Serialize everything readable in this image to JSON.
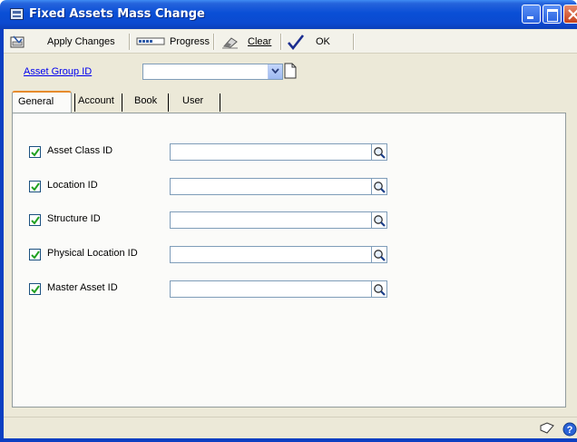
{
  "window": {
    "title": "Fixed Assets Mass Change",
    "icon": "window-form-icon",
    "controls": [
      "minimize-icon",
      "maximize-icon",
      "close-icon"
    ]
  },
  "toolbar": {
    "apply_changes": {
      "label": "Apply Changes",
      "icon": "apply-changes-icon"
    },
    "progress": {
      "label": "Progress",
      "icon": "progress-icon"
    },
    "clear": {
      "label": "Clear",
      "icon": "clear-eraser-icon"
    },
    "ok": {
      "label": "OK",
      "icon": "checkmark-icon"
    }
  },
  "header": {
    "asset_group_label": "Asset Group ID",
    "asset_group_value": ""
  },
  "tabs": [
    {
      "label": "General",
      "active": true
    },
    {
      "label": "Account",
      "active": false
    },
    {
      "label": "Book",
      "active": false
    },
    {
      "label": "User",
      "active": false
    }
  ],
  "fields": [
    {
      "label": "Asset Class ID",
      "checked": true,
      "value": ""
    },
    {
      "label": "Location ID",
      "checked": true,
      "value": ""
    },
    {
      "label": "Structure ID",
      "checked": true,
      "value": ""
    },
    {
      "label": "Physical Location ID",
      "checked": true,
      "value": ""
    },
    {
      "label": "Master Asset ID",
      "checked": true,
      "value": ""
    }
  ],
  "statusbar": {
    "icons": [
      "note-icon",
      "help-icon"
    ]
  },
  "colors": {
    "titlebar": "#0b4ad0",
    "client": "#ece9d8",
    "panel": "#fbfbf9",
    "link": "#0000ee",
    "active_tab_accent": "#e68b2c"
  }
}
